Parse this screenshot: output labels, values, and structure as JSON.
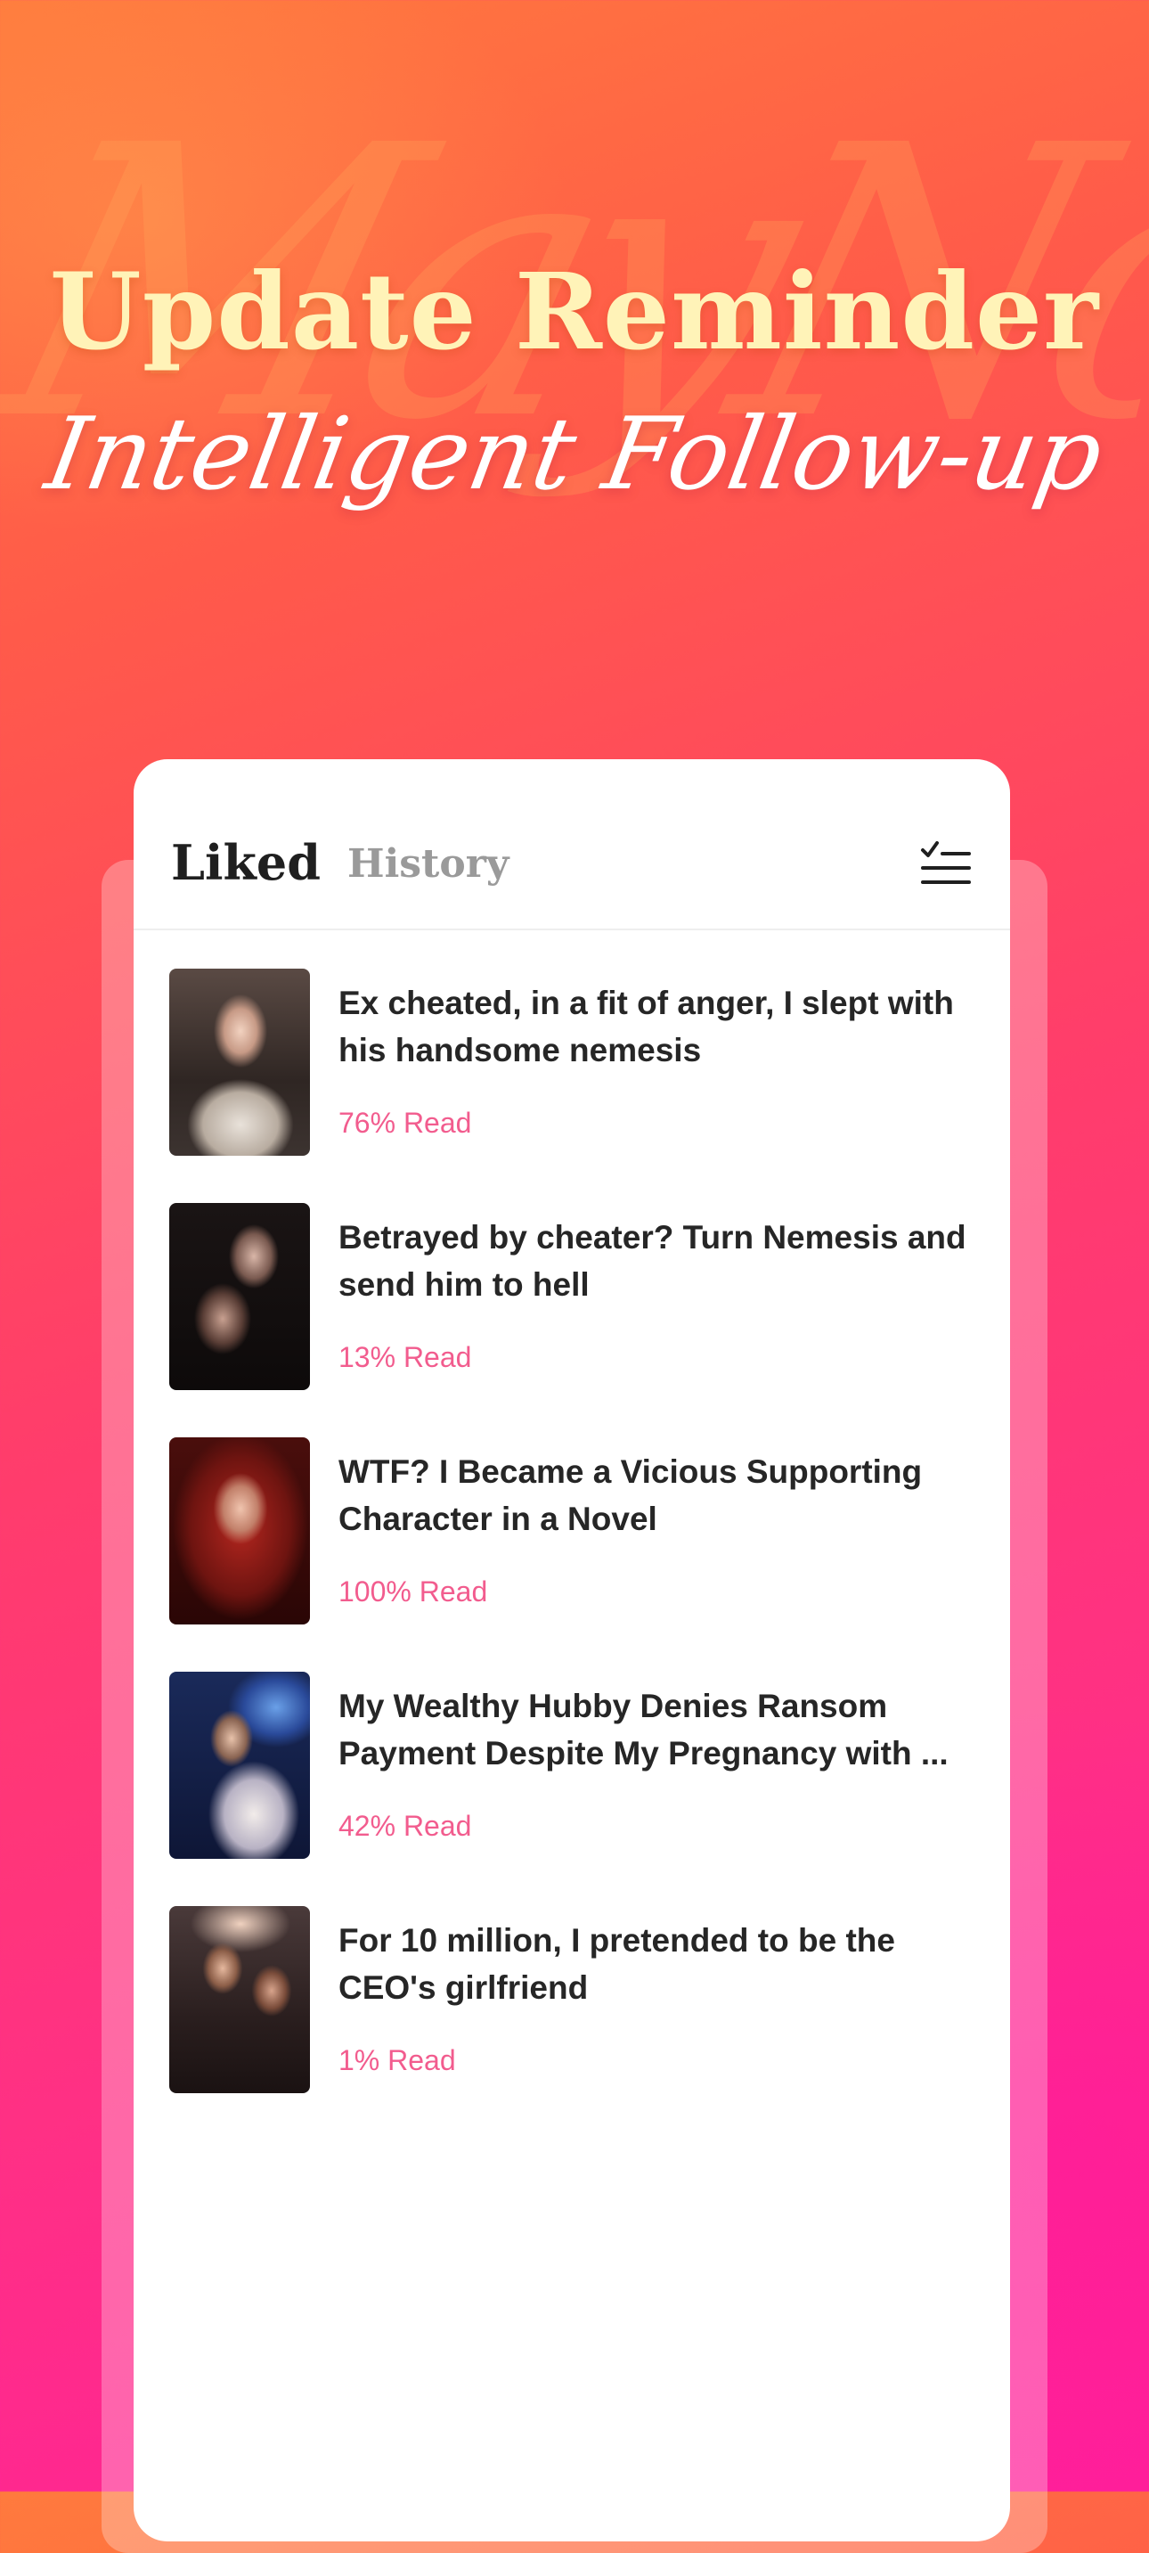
{
  "headline": "Update Reminder",
  "subline": "Intelligent Follow-up",
  "watermark": "MayNo",
  "tabs": {
    "liked": "Liked",
    "history": "History",
    "active": "Liked"
  },
  "filter_icon": "checklist-icon",
  "books": [
    {
      "title": "Ex cheated, in a fit of anger, I slept with his handsome nemesis",
      "progress": "76% Read"
    },
    {
      "title": "Betrayed by cheater? Turn Nemesis and send him to hell",
      "progress": "13% Read"
    },
    {
      "title": "WTF? I Became a Vicious Supporting Character in a Novel",
      "progress": "100% Read"
    },
    {
      "title": "My Wealthy Hubby Denies Ransom Payment Despite My Pregnancy with ...",
      "progress": "42% Read"
    },
    {
      "title": "For 10 million, I pretended to be the CEO's girlfriend",
      "progress": "1% Read"
    }
  ],
  "colors": {
    "accent": "#f25c8e",
    "headline": "#fff3b8",
    "title_text": "#262626",
    "tab_inactive": "#9a9a9a"
  }
}
